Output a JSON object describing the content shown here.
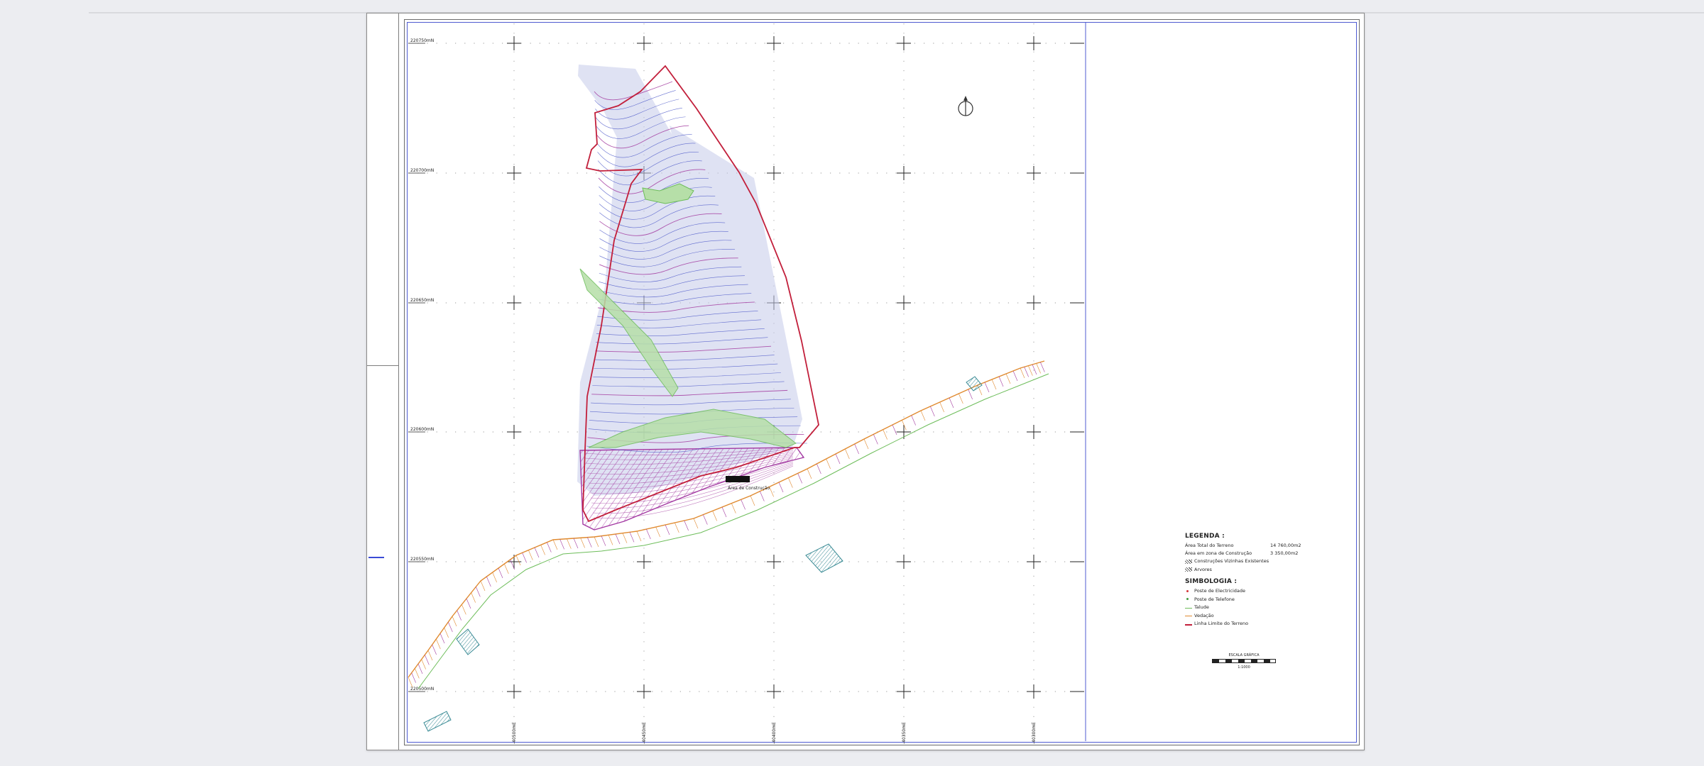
{
  "viewer": {
    "background": "#ecedf1"
  },
  "drawing": {
    "grid_labels_y": [
      "220750mN",
      "220700mN",
      "220650mN",
      "220600mN",
      "220550mN",
      "220500mN"
    ],
    "grid_labels_x": [
      "-40500mE",
      "-40450mE",
      "-40400mE",
      "-40350mE",
      "-40300mE"
    ],
    "colors": {
      "boundary": "#c21f3b",
      "contour_blue": "#4a56c8",
      "contour_magenta": "#a33ca0",
      "slope_green": "#7ec46c",
      "road_orange": "#e08a2f",
      "construction_zone": "#a43aa3",
      "shade": "#b7bde2"
    }
  },
  "legend": {
    "title": "LEGENDA :",
    "rows": [
      {
        "label": "Área Total do Terreno",
        "value": "14 760,00m2"
      },
      {
        "label": "Área em zona de Construção",
        "value": "3 350,00m2"
      }
    ],
    "items": [
      "Construções Vizinhas Existentes",
      "Arvores"
    ],
    "symbology_title": "SIMBOLOGIA :",
    "symbols": [
      {
        "label": "Poste de Electricidade",
        "icon": "electric-pole-icon"
      },
      {
        "label": "Poste de Telefone",
        "icon": "telephone-pole-icon"
      },
      {
        "label": "Talude",
        "icon": "slope-line-icon"
      },
      {
        "label": "Vedação",
        "icon": "fence-line-icon"
      },
      {
        "label": "Linha Limite do Terreno",
        "icon": "boundary-line-icon"
      }
    ]
  },
  "scale": {
    "title": "ESCALA GRÁFICA",
    "subtitle": "1:1000"
  }
}
